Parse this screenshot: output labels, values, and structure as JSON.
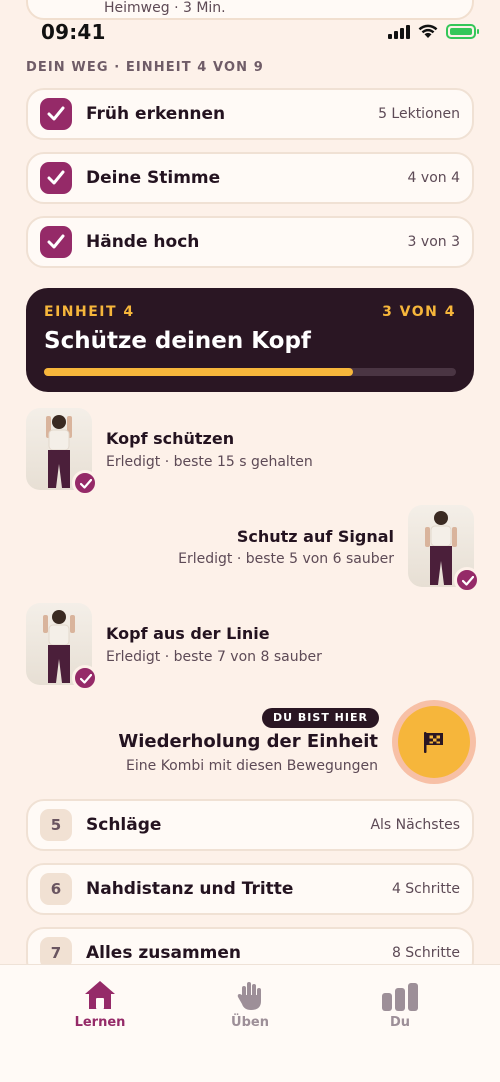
{
  "peek_card": {
    "subtitle": "Heimweg · 3 Min."
  },
  "status_bar": {
    "time": "09:41"
  },
  "path": {
    "section_label": "DEIN WEG · EINHEIT 4 VON 9"
  },
  "completed_units": [
    {
      "label": "Früh erkennen",
      "meta": "5 Lektionen"
    },
    {
      "label": "Deine Stimme",
      "meta": "4 von 4"
    },
    {
      "label": "Hände hoch",
      "meta": "3 von 3"
    }
  ],
  "current_unit": {
    "eyebrow": "EINHEIT 4",
    "progress_text": "3 VON 4",
    "title": "Schütze deinen Kopf",
    "progress_fraction": 0.75
  },
  "lessons": [
    {
      "title": "Kopf schützen",
      "subtitle": "Erledigt · beste 15 s gehalten"
    },
    {
      "title": "Schutz auf Signal",
      "subtitle": "Erledigt · beste 5 von 6 sauber"
    },
    {
      "title": "Kopf aus der Linie",
      "subtitle": "Erledigt · beste 7 von 8 sauber"
    }
  ],
  "current_lesson": {
    "badge": "DU BIST HIER",
    "title": "Wiederholung der Einheit",
    "subtitle": "Eine Kombi mit diesen Bewegungen"
  },
  "upcoming_units": [
    {
      "number": "5",
      "label": "Schläge",
      "meta": "Als Nächstes"
    },
    {
      "number": "6",
      "label": "Nahdistanz und Tritte",
      "meta": "4 Schritte"
    },
    {
      "number": "7",
      "label": "Alles zusammen",
      "meta": "8 Schritte"
    }
  ],
  "tabs": [
    {
      "label": "Lernen",
      "icon": "home-icon",
      "active": true
    },
    {
      "label": "Üben",
      "icon": "hand-icon",
      "active": false
    },
    {
      "label": "Du",
      "icon": "bar-chart-icon",
      "active": false
    }
  ],
  "colors": {
    "accent": "#952a68",
    "gold": "#f6b63b",
    "dark": "#2a1623",
    "background": "#fdf1e9"
  }
}
